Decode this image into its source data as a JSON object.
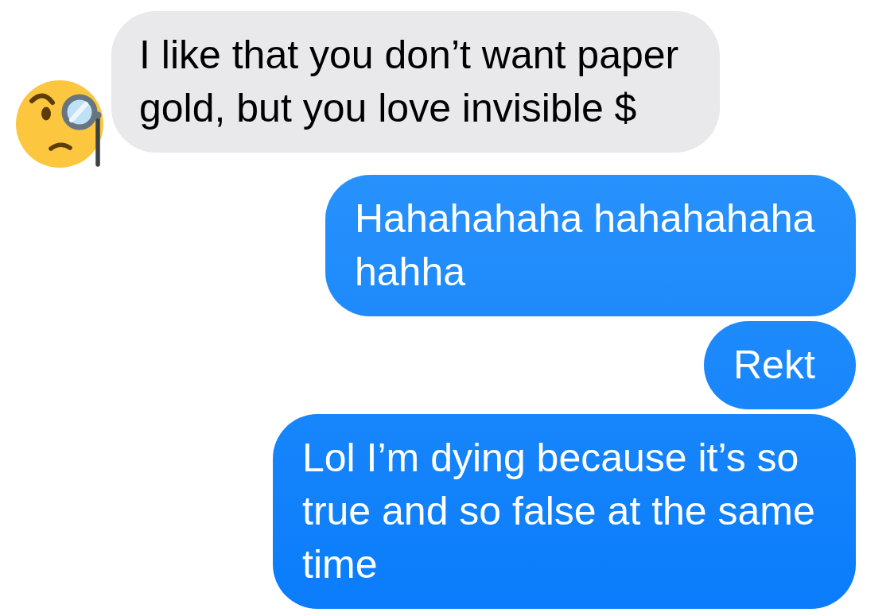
{
  "messages": [
    {
      "kind": "incoming",
      "text": "I like that you don’t want paper gold, but you love invisible $"
    },
    {
      "kind": "outgoing",
      "text": "Hahahahaha hahahahaha hahha"
    },
    {
      "kind": "outgoing",
      "text": "Rekt"
    },
    {
      "kind": "outgoing",
      "text": "Lol I’m dying because it’s so true and so false at the same time"
    }
  ]
}
